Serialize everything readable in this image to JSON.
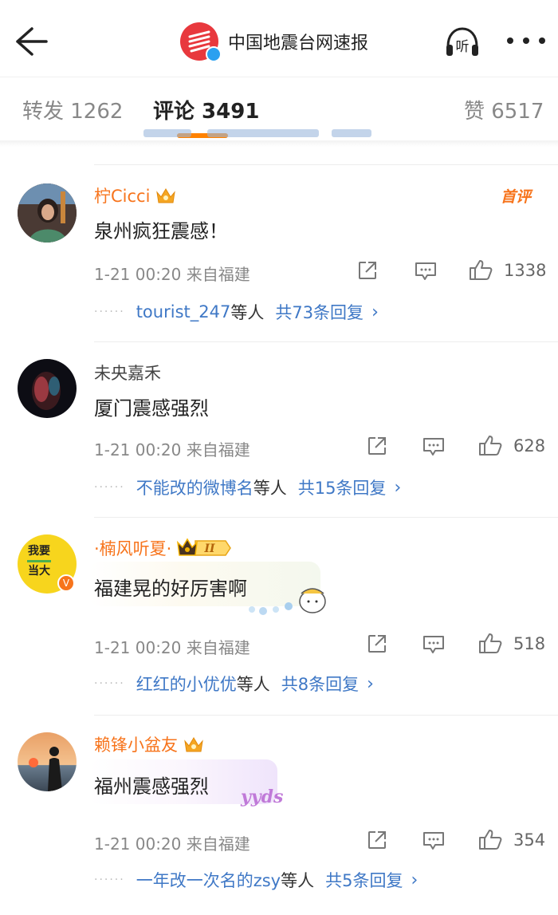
{
  "header": {
    "title": "中国地震台网速报",
    "listen_label": "听"
  },
  "tabs": [
    {
      "label": "转发 1262"
    },
    {
      "label": "评论 3491"
    },
    {
      "label": "赞 6517"
    }
  ],
  "comments": [
    {
      "user": "柠Cicci",
      "first_badge": "首评",
      "text": "泉州疯狂震感！",
      "meta": "1-21 00:20 来自福建",
      "likes": "1338",
      "reply_users": "tourist_247",
      "reply_suffix": "等人",
      "reply_count": "共73条回复"
    },
    {
      "user": "未央嘉禾",
      "text": "厦门震感强烈",
      "meta": "1-21 00:20 来自福建",
      "likes": "628",
      "reply_users": "不能改的微博名",
      "reply_suffix": "等人",
      "reply_count": "共15条回复"
    },
    {
      "user": "·楠风听夏·",
      "avatar_text_1": "我要",
      "avatar_text_2": "当大",
      "text": "福建晃的好厉害啊",
      "meta": "1-21 00:20 来自福建",
      "likes": "518",
      "reply_users": "红红的小优优",
      "reply_suffix": "等人",
      "reply_count": "共8条回复"
    },
    {
      "user": "赖锋小盆友",
      "text": "福州震感强烈",
      "bubble_sticker": "yyds",
      "meta": "1-21 00:20 来自福建",
      "likes": "354",
      "reply_users": "一年改一次名的zsy",
      "reply_suffix": "等人",
      "reply_count": "共5条回复"
    }
  ],
  "colors": {
    "accent": "#ff8200",
    "vip_name": "#f7741c",
    "link": "#3f78c6",
    "logo": "#e8383d"
  },
  "icons": [
    "back-arrow-icon",
    "headphone-icon",
    "more-icon",
    "share-icon",
    "comment-icon",
    "like-icon",
    "crown-icon",
    "chevron-right-icon"
  ]
}
